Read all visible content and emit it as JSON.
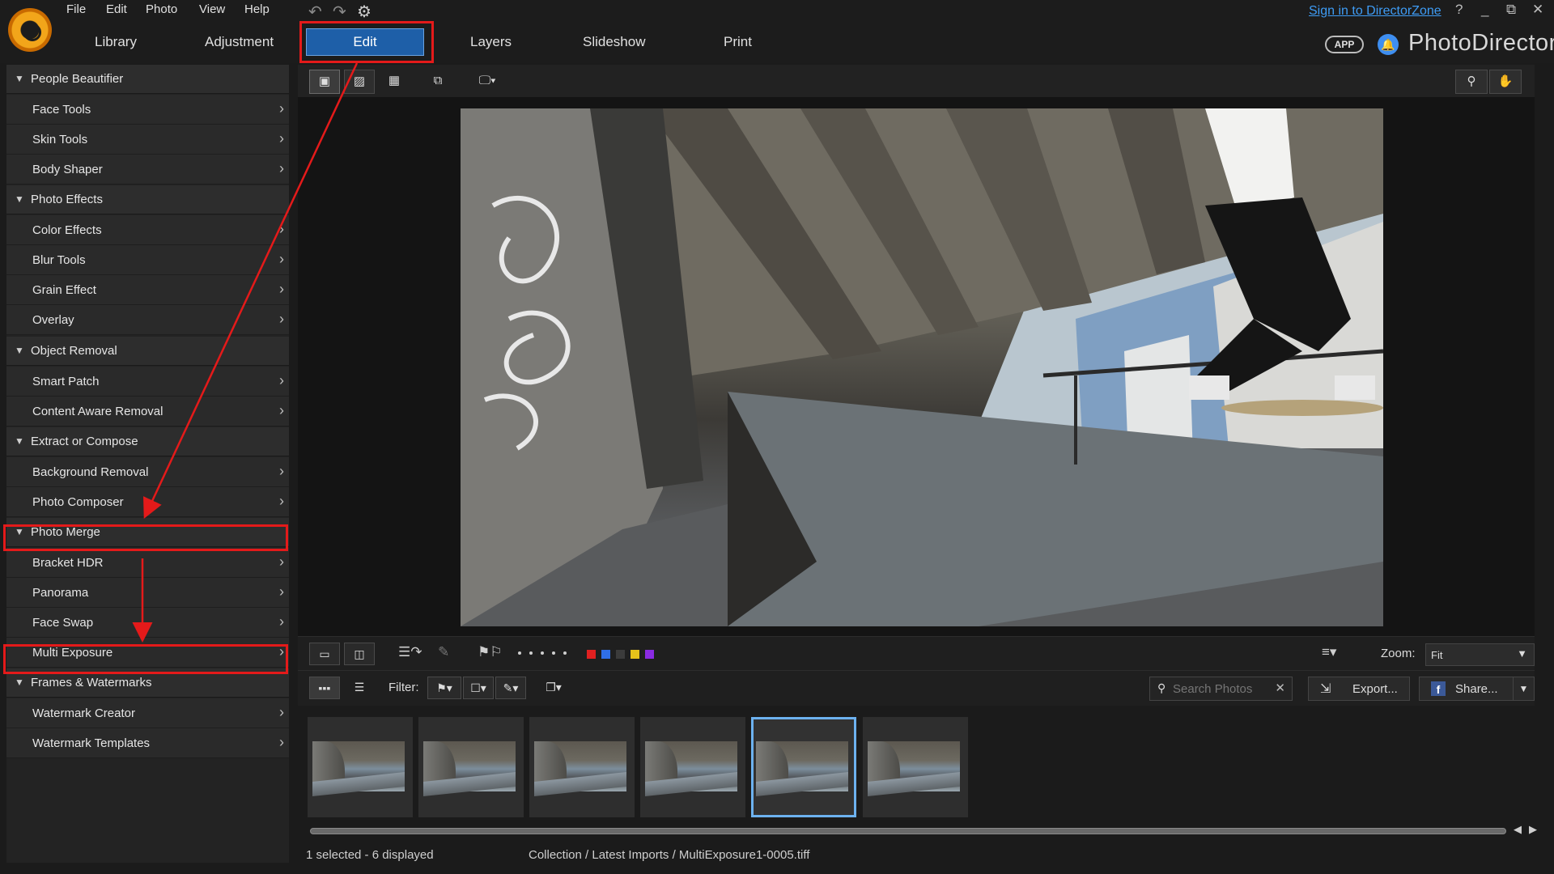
{
  "menu": [
    "File",
    "Edit",
    "Photo",
    "View",
    "Help"
  ],
  "window": {
    "sign_in": "Sign in to DirectorZone",
    "help": "?",
    "minimize": "_",
    "restore": "⧉",
    "close": "✕"
  },
  "library_tabs": [
    "Library",
    "Adjustment"
  ],
  "mode_tabs": {
    "active": "Edit",
    "others": [
      "Layers",
      "Slideshow",
      "Print"
    ]
  },
  "brand": {
    "app_badge": "APP",
    "name": "PhotoDirector"
  },
  "left_panel": {
    "sections": [
      {
        "label": "People Beautifier",
        "items": [
          "Face Tools",
          "Skin Tools",
          "Body Shaper"
        ]
      },
      {
        "label": "Photo Effects",
        "items": [
          "Color Effects",
          "Blur Tools",
          "Grain Effect",
          "Overlay"
        ]
      },
      {
        "label": "Object Removal",
        "items": [
          "Smart Patch",
          "Content Aware Removal"
        ]
      },
      {
        "label": "Extract or Compose",
        "items": [
          "Background Removal",
          "Photo Composer"
        ]
      },
      {
        "label": "Photo Merge",
        "items": [
          "Bracket HDR",
          "Panorama",
          "Face Swap",
          "Multi Exposure"
        ]
      },
      {
        "label": "Frames & Watermarks",
        "items": [
          "Watermark Creator",
          "Watermark Templates"
        ]
      }
    ]
  },
  "color_labels": [
    "#e02020",
    "#2f6fe8",
    "#3b3b3b",
    "#e6c21a",
    "#8a2be2"
  ],
  "filmstrip_toolbar": {
    "filter_label": "Filter:",
    "search_placeholder": "Search Photos",
    "export_label": "Export...",
    "share_label": "Share...",
    "zoom_label": "Zoom:",
    "zoom_value": "Fit"
  },
  "thumbnails": {
    "count": 6,
    "selected_index": 4
  },
  "status": {
    "selection": "1 selected - 6 displayed",
    "path": "Collection / Latest Imports / MultiExposure1-0005.tiff"
  },
  "annotation_color": "#e41a1a"
}
